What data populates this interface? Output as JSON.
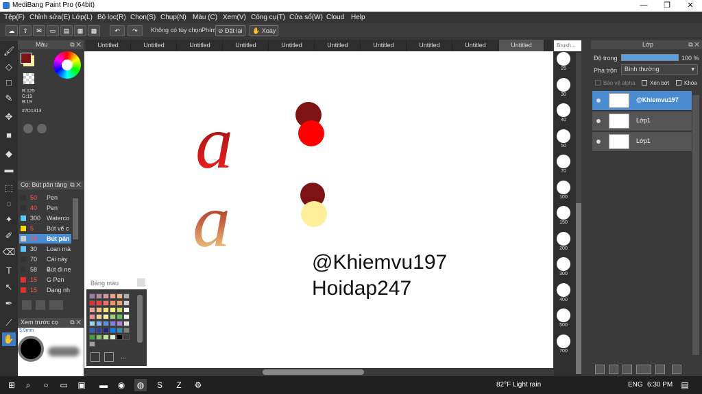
{
  "window": {
    "title": "MediBang Paint Pro (64bit)"
  },
  "menu": [
    "Tệp(F)",
    "Chỉnh sửa(E)",
    "Lớp(L)",
    "Bộ lọc(R)",
    "Chọn(S)",
    "Chụp(N)",
    "Màu (C)",
    "Xem(V)",
    "Công cụ(T)",
    "Cửa sổ(W)",
    "Cloud",
    "Help"
  ],
  "toolbar": {
    "option": "Không có tùy chọn",
    "key_label": "Phím",
    "reset": "Đặt lại",
    "rotate": "Xoay"
  },
  "color_panel": {
    "title": "Màu",
    "r": "R:125",
    "g": "G:19",
    "b": "B:19",
    "hex": "#7D1313",
    "primary": "#7D1313",
    "secondary": "#ffef9a"
  },
  "tabs": [
    "Untitled",
    "Untitled",
    "Untitled",
    "Untitled",
    "Untitled",
    "Untitled",
    "Untitled",
    "Untitled",
    "Untitled",
    "Untitled"
  ],
  "brush_panel": {
    "title": "Cọ: Bút pản tảng",
    "items": [
      {
        "size": "50",
        "name": "Pen",
        "color": "#333333"
      },
      {
        "size": "40",
        "name": "Pen",
        "color": "#333333"
      },
      {
        "size": "300",
        "name": "Waterco",
        "color": "#5ac8fa"
      },
      {
        "size": "5",
        "name": "Bút vẽ c",
        "color": "#f5d70a"
      },
      {
        "size": "70",
        "name": "Bút pản",
        "color": "#cccccc"
      },
      {
        "size": "30",
        "name": "Loan mà",
        "color": "#5ac8fa"
      },
      {
        "size": "70",
        "name": "Cái này c",
        "color": "#333333"
      },
      {
        "size": "58",
        "name": "Bút đi ne",
        "color": "#333333"
      },
      {
        "size": "15",
        "name": "G Pen",
        "color": "#e03030"
      },
      {
        "size": "15",
        "name": "Dạng nh",
        "color": "#e03030"
      }
    ]
  },
  "preview": {
    "title": "Xem trước cọ",
    "size": "5.9mm"
  },
  "palette": {
    "title": "Bảng màu",
    "dots": "..."
  },
  "brush_strip": {
    "title": "Brush...",
    "sizes": [
      "25",
      "30",
      "40",
      "50",
      "70",
      "100",
      "150",
      "200",
      "300",
      "400",
      "500",
      "700"
    ]
  },
  "layer_panel": {
    "title": "Lớp",
    "opacity_label": "Độ trong",
    "opacity_value": "100 %",
    "blend_label": "Pha trộn",
    "blend_value": "Bình thường",
    "protect_alpha": "Bảo vệ alpha",
    "clip": "Xén bớt",
    "lock": "Khóa",
    "layers": [
      "@Khiemvu197",
      "Lớp1",
      "Lớp1"
    ]
  },
  "canvas": {
    "line1": "@Khiemvu197",
    "line2": "Hoidap247",
    "glyph_top": "a",
    "glyph_bottom": "a"
  },
  "taskbar": {
    "weather": "82°F  Light rain",
    "lang": "ENG",
    "time": "6:30 PM"
  }
}
